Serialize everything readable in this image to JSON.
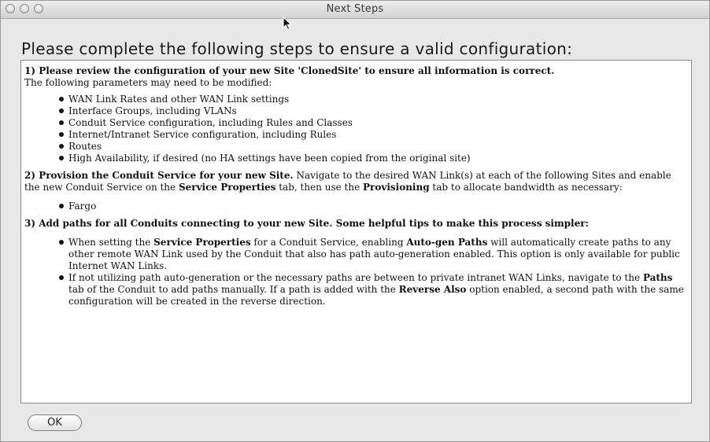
{
  "window": {
    "title": "Next Steps"
  },
  "heading": "Please complete the following steps to ensure a valid configuration:",
  "step1": {
    "title": "1) Please review the configuration of your new Site 'ClonedSite' to ensure all information is correct.",
    "subtitle": "The following parameters may need to be modified:",
    "items": [
      "WAN Link Rates and other WAN Link settings",
      "Interface Groups, including VLANs",
      "Conduit Service configuration, including Rules and Classes",
      "Internet/Intranet Service configuration, including Rules",
      "Routes",
      "High Availability, if desired (no HA settings have been copied from the original site)"
    ]
  },
  "step2": {
    "title": "2) Provision the Conduit Service for your new Site.",
    "text_a": " Navigate to the desired WAN Link(s) at each of the following Sites and enable the new Conduit Service on the ",
    "bold_a": "Service Properties",
    "text_b": " tab, then use the ",
    "bold_b": "Provisioning",
    "text_c": " tab to allocate bandwidth as necessary:",
    "items": [
      "Fargo"
    ]
  },
  "step3": {
    "title": "3) Add paths for all Conduits connecting to your new Site. Some helpful tips to make this process simpler:",
    "tip1": {
      "t1": "When setting the ",
      "b1": "Service Properties",
      "t2": " for a Conduit Service, enabling ",
      "b2": "Auto-gen Paths",
      "t3": " will automatically create paths to any other remote WAN Link used by the Conduit that also has path auto-generation enabled. This option is only available for public Internet WAN Links."
    },
    "tip2": {
      "t1": "If not utilizing path auto-generation or the necessary paths are between to private intranet WAN Links, navigate to the ",
      "b1": "Paths",
      "t2": " tab of the Conduit to add paths manually. If a path is added with the ",
      "b2": "Reverse Also",
      "t3": " option enabled, a second path with the same configuration will be created in the reverse direction."
    }
  },
  "buttons": {
    "ok": "OK"
  }
}
